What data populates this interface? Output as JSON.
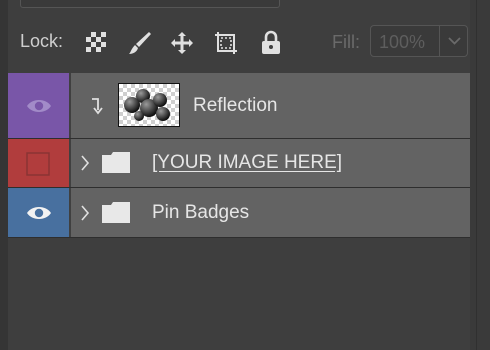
{
  "lock_bar": {
    "label": "Lock:",
    "icons": [
      "transparency-lock-icon",
      "brush-icon",
      "move-icon",
      "artboard-icon",
      "padlock-icon"
    ],
    "fill_label": "Fill:",
    "fill_value": "100%"
  },
  "layers": [
    {
      "name": "Reflection",
      "visible": true,
      "color": "#7956a8",
      "type": "clipped-layer",
      "icons": [
        "clip-arrow-icon",
        "layer-thumbnail"
      ]
    },
    {
      "name": "[YOUR IMAGE HERE]",
      "visible": false,
      "color": "#b13d3d",
      "type": "group",
      "icons": [
        "chevron-right-icon",
        "folder-icon"
      ]
    },
    {
      "name": "Pin Badges",
      "visible": true,
      "color": "#48709f",
      "type": "group",
      "icons": [
        "chevron-right-icon",
        "folder-icon"
      ]
    }
  ],
  "colors": {
    "panel_bg": "#3e3e3e",
    "row_bg": "#636363",
    "text": "#e6e6e6"
  }
}
